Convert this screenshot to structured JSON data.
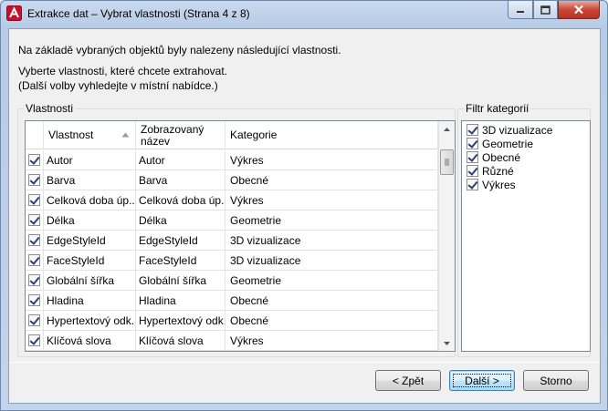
{
  "window": {
    "title": "Extrakce dat – Vybrat vlastnosti (Strana 4 z 8)"
  },
  "intro": {
    "line1": "Na základě vybraných objektů byly nalezeny následující vlastnosti.",
    "line2": "Vyberte vlastnosti, které chcete extrahovat.",
    "line3": "(Další volby vyhledejte v místní nabídce.)"
  },
  "properties_group": {
    "label": "Vlastnosti",
    "columns": [
      "Vlastnost",
      "Zobrazovaný název",
      "Kategorie"
    ],
    "rows": [
      {
        "checked": true,
        "property": "Autor",
        "display": "Autor",
        "category": "Výkres"
      },
      {
        "checked": true,
        "property": "Barva",
        "display": "Barva",
        "category": "Obecné"
      },
      {
        "checked": true,
        "property": "Celková doba úp...",
        "display": "Celková doba úp...",
        "category": "Výkres"
      },
      {
        "checked": true,
        "property": "Délka",
        "display": "Délka",
        "category": "Geometrie"
      },
      {
        "checked": true,
        "property": "EdgeStyleId",
        "display": "EdgeStyleId",
        "category": "3D vizualizace"
      },
      {
        "checked": true,
        "property": "FaceStyleId",
        "display": "FaceStyleId",
        "category": "3D vizualizace"
      },
      {
        "checked": true,
        "property": "Globální šířka",
        "display": "Globální šířka",
        "category": "Geometrie"
      },
      {
        "checked": true,
        "property": "Hladina",
        "display": "Hladina",
        "category": "Obecné"
      },
      {
        "checked": true,
        "property": "Hypertextový odk...",
        "display": "Hypertextový odk...",
        "category": "Obecné"
      },
      {
        "checked": true,
        "property": "Klíčová slova",
        "display": "Klíčová slova",
        "category": "Výkres"
      }
    ]
  },
  "filter_group": {
    "label": "Filtr kategorií",
    "items": [
      {
        "checked": true,
        "label": "3D vizualizace"
      },
      {
        "checked": true,
        "label": "Geometrie"
      },
      {
        "checked": true,
        "label": "Obecné"
      },
      {
        "checked": true,
        "label": "Různé"
      },
      {
        "checked": true,
        "label": "Výkres"
      }
    ]
  },
  "buttons": {
    "back": "< Zpět",
    "next": "Další >",
    "cancel": "Storno"
  },
  "colors": {
    "accent": "#3c7fb1",
    "check": "#2b3f77",
    "close_button": "#c9473a"
  }
}
